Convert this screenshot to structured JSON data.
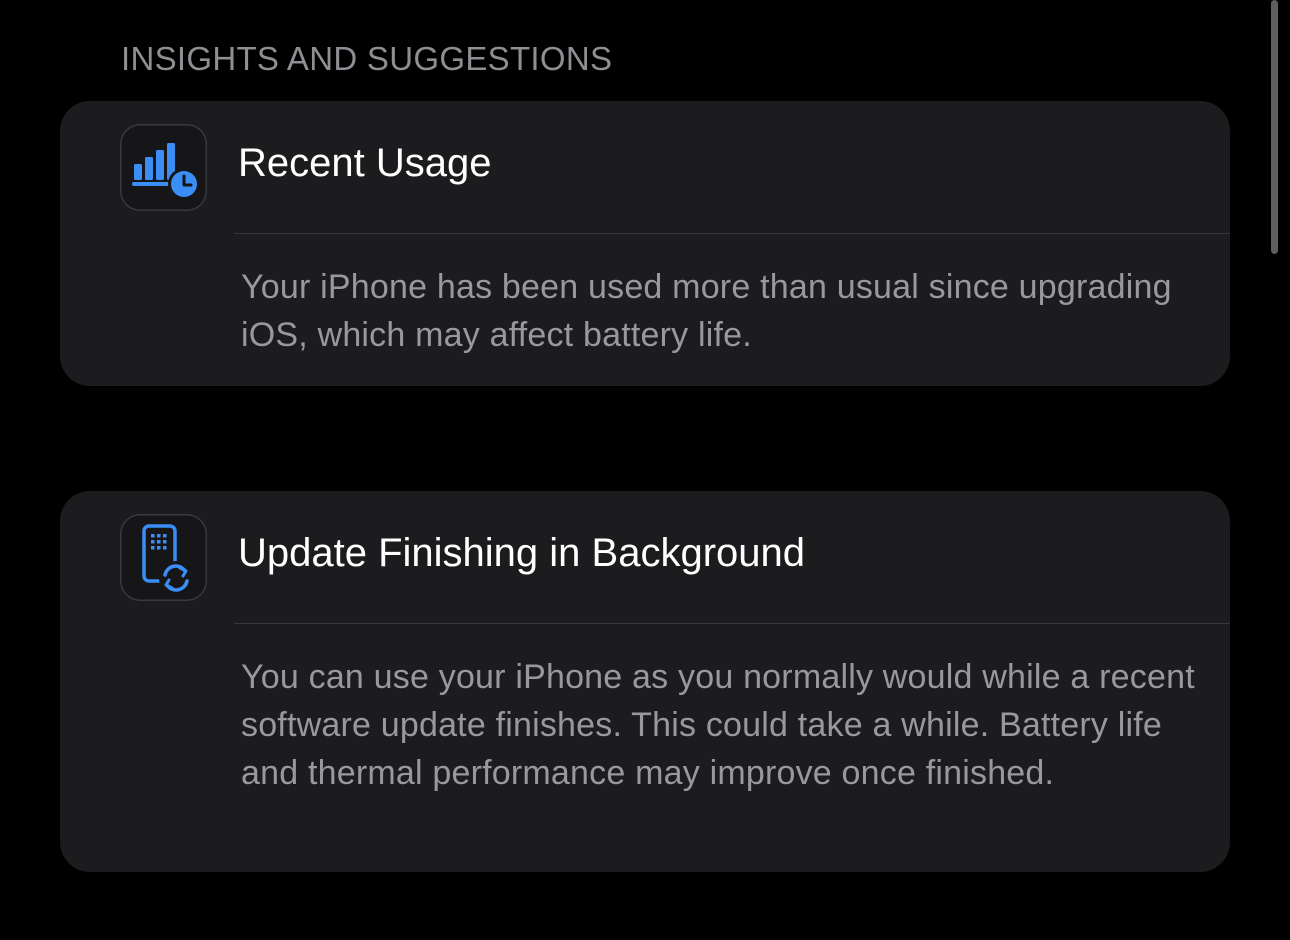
{
  "section": {
    "header": "INSIGHTS AND SUGGESTIONS"
  },
  "cards": [
    {
      "icon": "recent-usage-chart-clock-icon",
      "title": "Recent Usage",
      "body": "Your iPhone has been used more than usual since upgrading iOS, which may affect battery life."
    },
    {
      "icon": "update-phone-sync-icon",
      "title": "Update Finishing in Background",
      "body": "You can use your iPhone as you normally would while a recent software update finishes. This could take a while. Battery life and thermal performance may improve once finished."
    }
  ],
  "colors": {
    "background": "#000000",
    "card_background": "#1c1c1e",
    "accent_blue": "#3a8ef6",
    "secondary_text": "#8e8e93"
  }
}
